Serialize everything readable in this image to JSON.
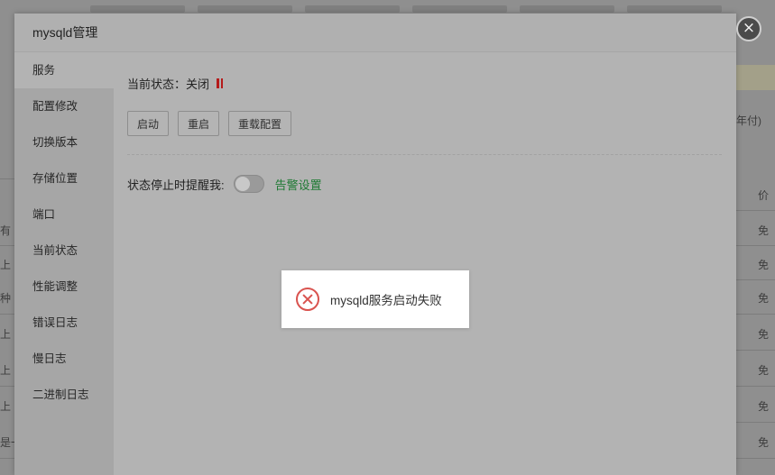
{
  "background": {
    "right_header_text": "年付)",
    "right_col_header": "价",
    "right_cells": [
      "免",
      "免",
      "免",
      "免",
      "免",
      "免",
      "免"
    ],
    "left_fragments": [
      "有",
      "上",
      "种",
      "上",
      "上",
      "上",
      "是一"
    ]
  },
  "modal": {
    "title": "mysqld管理",
    "close_label": "×"
  },
  "sidebar": {
    "items": [
      {
        "label": "服务"
      },
      {
        "label": "配置修改"
      },
      {
        "label": "切换版本"
      },
      {
        "label": "存储位置"
      },
      {
        "label": "端口"
      },
      {
        "label": "当前状态"
      },
      {
        "label": "性能调整"
      },
      {
        "label": "错误日志"
      },
      {
        "label": "慢日志"
      },
      {
        "label": "二进制日志"
      }
    ]
  },
  "service": {
    "status_label": "当前状态：",
    "status_value": "关闭",
    "status_icon": "pause-icon",
    "buttons": {
      "start": "启动",
      "restart": "重启",
      "reload": "重载配置"
    },
    "alert_label": "状态停止时提醒我:",
    "alert_enabled": false,
    "alert_link": "告警设置"
  },
  "toast": {
    "icon": "error-icon",
    "message": "mysqld服务启动失败"
  },
  "colors": {
    "status_icon": "#b51b1b",
    "alert_link": "#1f7a34",
    "toast_icon": "#d9534f"
  }
}
